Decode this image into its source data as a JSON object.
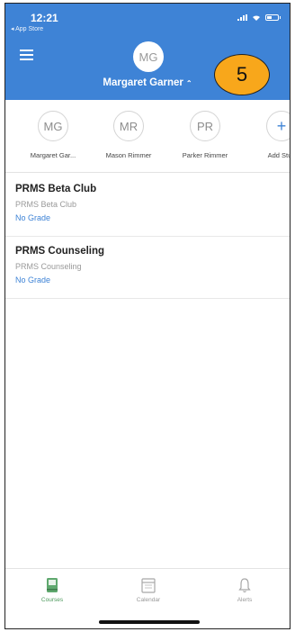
{
  "status": {
    "time": "12:21",
    "back_label": "◂ App Store"
  },
  "header": {
    "avatar_initials": "MG",
    "student_name": "Margaret Garner",
    "chevron": "⌃"
  },
  "callout": {
    "number": "5"
  },
  "students": [
    {
      "initials": "MG",
      "name": "Margaret Gar..."
    },
    {
      "initials": "MR",
      "name": "Mason Rimmer"
    },
    {
      "initials": "PR",
      "name": "Parker Rimmer"
    },
    {
      "initials": "+",
      "name": "Add Stud"
    }
  ],
  "courses": [
    {
      "title": "PRMS Beta Club",
      "subtitle": "PRMS Beta Club",
      "grade": "No Grade"
    },
    {
      "title": "PRMS Counseling",
      "subtitle": "PRMS Counseling",
      "grade": "No Grade"
    }
  ],
  "tabs": [
    {
      "label": "Courses",
      "icon": "book-icon",
      "active": true
    },
    {
      "label": "Calendar",
      "icon": "calendar-icon",
      "active": false
    },
    {
      "label": "Alerts",
      "icon": "bell-icon",
      "active": false
    }
  ],
  "colors": {
    "header": "#3e83d6",
    "callout": "#f8a71b",
    "active_tab": "#4e9a5e",
    "link": "#3e83d6"
  }
}
